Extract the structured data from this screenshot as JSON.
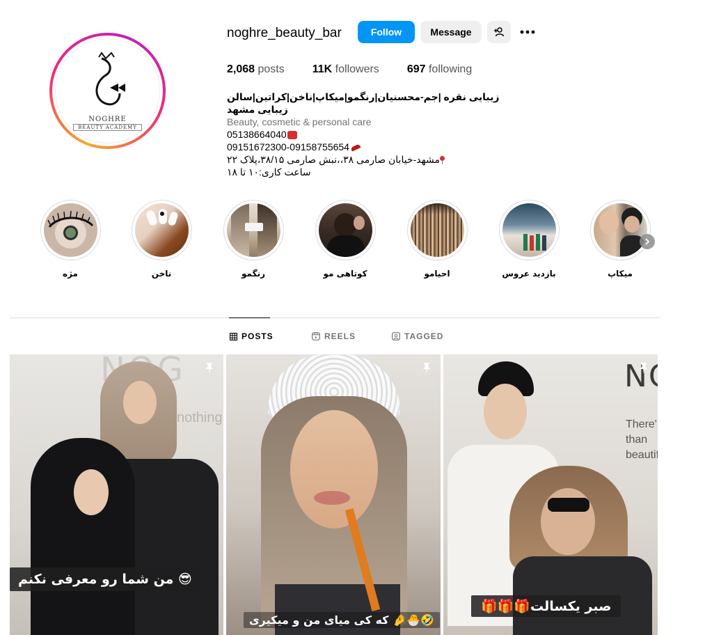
{
  "profile": {
    "username": "noghre_beauty_bar",
    "avatar": {
      "brand": "NOGHRE",
      "subtitle": "BEAUTY ACADEMY"
    },
    "actions": {
      "follow_label": "Follow",
      "message_label": "Message",
      "add_user_icon": "person-add-icon",
      "more_icon": "more-horizontal-icon"
    },
    "stats": {
      "posts_count": "2,068",
      "posts_label": "posts",
      "followers_count": "11K",
      "followers_label": "followers",
      "following_count": "697",
      "following_label": "following"
    },
    "bio": {
      "name": "زیبایی نقره |جم-محسنیان|رنگمو|میکاپ|ناخن|کراتین|سالن زیبایی مشهد",
      "category": "Beauty, cosmetic & personal care",
      "phone_landline": "05138664040",
      "phone_mobile": "09151672300-09158755654",
      "address": "مشهد-خیابان صارمی ۳۸،،نبش صارمی ۳۸/۱۵،پلاک ۲۲",
      "hours": "ساعت کاری:۱۰ تا ۱۸"
    }
  },
  "highlights": [
    {
      "label": "مژه"
    },
    {
      "label": "ناخن"
    },
    {
      "label": "رنگمو"
    },
    {
      "label": "کوتاهی مو"
    },
    {
      "label": "احیامو"
    },
    {
      "label": "بازدید عروس"
    },
    {
      "label": "میکاپ"
    }
  ],
  "tabs": [
    {
      "label": "POSTS",
      "icon": "grid-icon",
      "active": true
    },
    {
      "label": "REELS",
      "icon": "reels-icon",
      "active": false
    },
    {
      "label": "TAGGED",
      "icon": "tagged-icon",
      "active": false
    }
  ],
  "posts": [
    {
      "caption": "من شما رو معرفی نکنم 😎",
      "pinned": true,
      "bg_text": "NOG",
      "wall_text": "nothing"
    },
    {
      "caption": "که کی میای من و میکیری 🤌🐣🤣",
      "pinned": true
    },
    {
      "caption": "🎁🎁🎁صبر یکسالت",
      "pinned": true,
      "bg_text": "NO",
      "wall_text_1": "There'",
      "wall_text_2": "than",
      "wall_text_3": "beautif"
    }
  ],
  "colors": {
    "follow_blue": "#0095f6",
    "secondary_button": "#efefef",
    "muted_text": "#737373",
    "divider": "#dbdbdb"
  }
}
